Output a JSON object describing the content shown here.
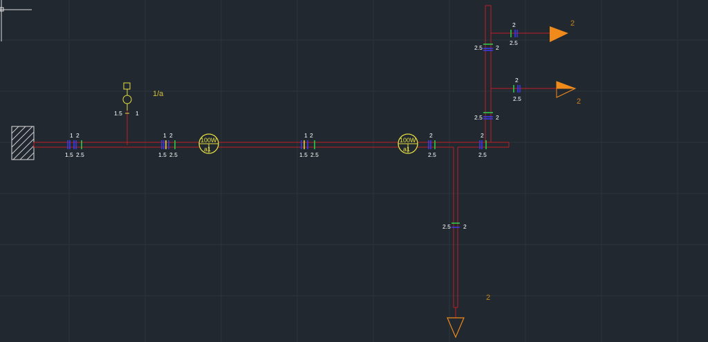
{
  "colors": {
    "background": "#212830",
    "grid": "#2b333d",
    "conduit": "#c41e24",
    "marker_blue": "#3a3af0",
    "marker_green": "#2ed34a",
    "marker_yellow": "#e8e040",
    "fixture": "#e8e040",
    "arrow_orange": "#f08a1a",
    "text": "#ffffff",
    "text_orange": "#c8861e"
  },
  "drawing": {
    "top_branch": {
      "row1": {
        "top": "2",
        "left": "",
        "right": ""
      },
      "row1_below": "2.5",
      "mid_left": "2.5",
      "mid_right": "2",
      "row2": {
        "top": "2",
        "below": "2.5"
      },
      "lower_left": "2.5",
      "lower_right": "2",
      "circuit_1": "2",
      "circuit_2": "2"
    },
    "light": {
      "label": "1/a",
      "left": "1.5",
      "right": "1"
    },
    "main_run": [
      {
        "top": "1",
        "top2": "2",
        "bottom": "1.5",
        "bottom2": "2.5"
      },
      {
        "top": "1",
        "top2": "2",
        "bottom": "1.5",
        "bottom2": "2.5"
      },
      {
        "top": "1",
        "top2": "2",
        "bottom": "1.5",
        "bottom2": "2.5"
      },
      {
        "top": "2",
        "bottom": "2.5"
      },
      {
        "top": "2",
        "bottom": "2.5"
      }
    ],
    "sockets": [
      {
        "power": "100W",
        "tag": "a1"
      },
      {
        "power": "100W",
        "tag": "a1"
      }
    ],
    "down_branch": {
      "left": "2.5",
      "right": "2",
      "circuit": "2"
    }
  }
}
